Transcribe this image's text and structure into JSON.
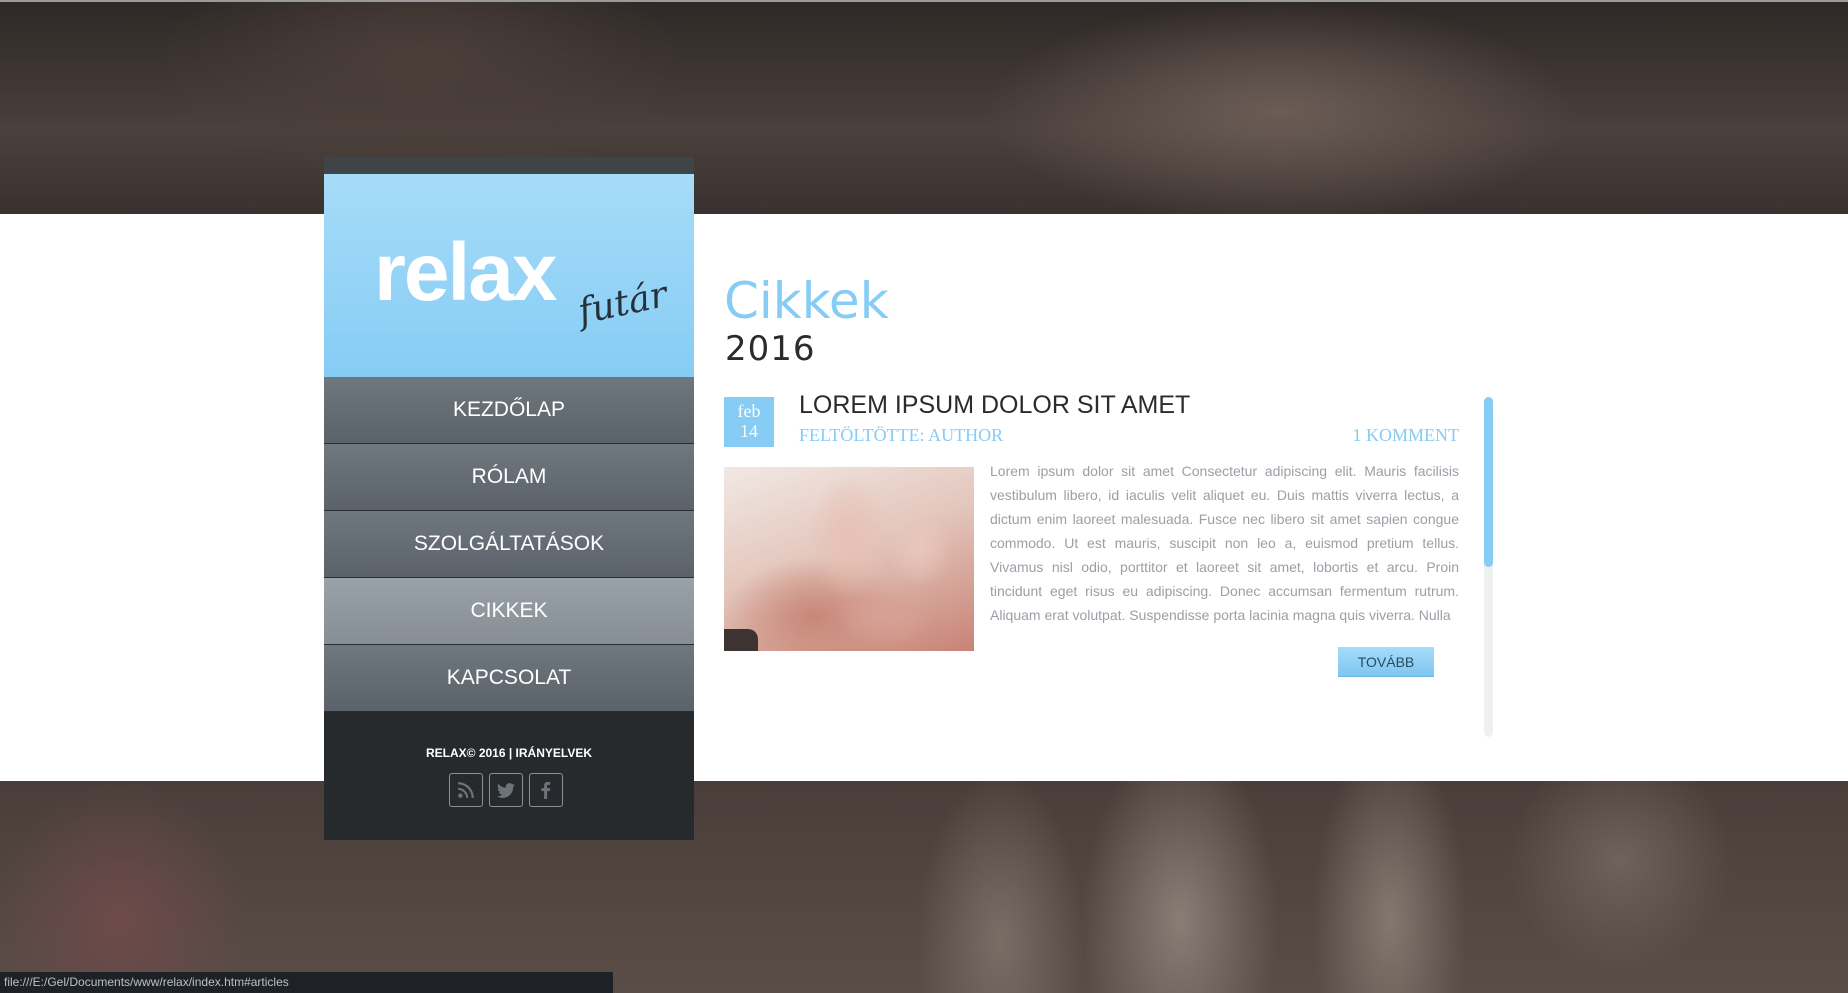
{
  "brand": {
    "logo_main": "relax",
    "logo_sub": "futár"
  },
  "nav": {
    "items": [
      {
        "label": "KEZDŐLAP",
        "active": false
      },
      {
        "label": "RÓLAM",
        "active": false
      },
      {
        "label": "SZOLGÁLTATÁSOK",
        "active": false
      },
      {
        "label": "CIKKEK",
        "active": true
      },
      {
        "label": "KAPCSOLAT",
        "active": false
      }
    ]
  },
  "sidebar_footer": {
    "copyright": "RELAX© 2016 | IRÁNYELVEK",
    "socials": [
      "rss-icon",
      "twitter-icon",
      "facebook-icon"
    ]
  },
  "page": {
    "title": "Cikkek",
    "year": "2016"
  },
  "article": {
    "date_month": "feb",
    "date_day": "14",
    "title": "LOREM IPSUM DOLOR SIT AMET",
    "author": "FELTÖLTÖTTE: AUTHOR",
    "comments": "1 KOMMENT",
    "body": "Lorem ipsum dolor sit amet Consectetur adipiscing elit. Mauris facilisis vestibulum libero, id iaculis velit aliquet eu. Duis mattis viverra lectus, a dictum enim laoreet malesuada. Fusce nec libero sit amet sapien congue commodo. Ut est mauris, suscipit non leo a, euismod pretium tellus. Vivamus nisl odio, porttitor et laoreet sit amet, lobortis et arcu. Proin tincidunt eget risus eu adipiscing. Donec accumsan fermentum rutrum. Aliquam erat volutpat. Suspendisse porta lacinia magna quis viverra. Nulla",
    "more_label": "TOVÁBB"
  },
  "status_bar": {
    "url": "file:///E:/Gel/Documents/www/relax/index.htm#articles"
  },
  "colors": {
    "accent": "#86ccf5",
    "nav": "#6f777f",
    "nav_active": "#9aa2a9",
    "sidebar_footer": "#262a2d"
  }
}
